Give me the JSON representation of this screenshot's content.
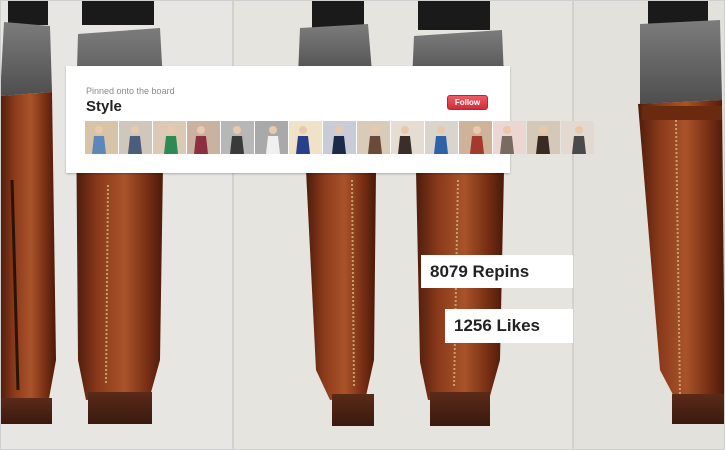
{
  "board_card": {
    "eyebrow": "Pinned onto the board",
    "title": "Style",
    "follow_label": "Follow",
    "thumbnails": [
      {
        "color": "#d7c3a8",
        "accent": "#5f86b8"
      },
      {
        "color": "#cfc7bb",
        "accent": "#4a5d7a"
      },
      {
        "color": "#dbc9b6",
        "accent": "#2e8a54"
      },
      {
        "color": "#c9b3a0",
        "accent": "#8c2f3e"
      },
      {
        "color": "#b7b7b7",
        "accent": "#3a3a3a"
      },
      {
        "color": "#a9a9a9",
        "accent": "#f0f0f0"
      },
      {
        "color": "#efe2c6",
        "accent": "#2a3f8c"
      },
      {
        "color": "#c9ccd6",
        "accent": "#1c2a4a"
      },
      {
        "color": "#d8cbb8",
        "accent": "#6a4a3a"
      },
      {
        "color": "#e6ddd2",
        "accent": "#3b2e2a"
      },
      {
        "color": "#d9d4cc",
        "accent": "#2f63a8"
      },
      {
        "color": "#cfb29a",
        "accent": "#a23a2e"
      },
      {
        "color": "#ecd6d2",
        "accent": "#7a6a62"
      },
      {
        "color": "#d6c8b8",
        "accent": "#3a2a22"
      },
      {
        "color": "#e2dad0",
        "accent": "#4a4a4a"
      }
    ]
  },
  "stats": {
    "repins": "8079 Repins",
    "likes": "1256 Likes"
  },
  "colors": {
    "follow_button": "#e0444c",
    "boot_leather": "#8a3a1a",
    "background": "#e4e2dd"
  }
}
